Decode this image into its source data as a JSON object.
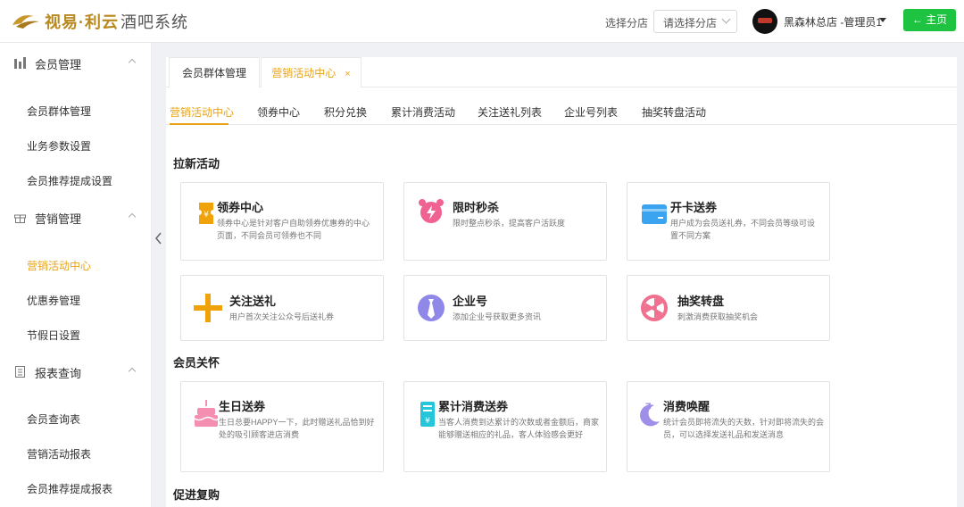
{
  "header": {
    "brand_main": "视易·利云",
    "brand_sub": "酒吧系统",
    "branch_label": "选择分店",
    "branch_placeholder": "请选择分店",
    "user_name": "黑森林总店 -管理员1",
    "home_button": "← 主页"
  },
  "sidebar": {
    "groups": [
      {
        "label": "会员管理",
        "items": [
          "会员群体管理",
          "业务参数设置",
          "会员推荐提成设置"
        ]
      },
      {
        "label": "营销管理",
        "items": [
          "营销活动中心",
          "优惠券管理",
          "节假日设置"
        ]
      },
      {
        "label": "报表查询",
        "items": [
          "会员查询表",
          "营销活动报表",
          "会员推荐提成报表"
        ]
      }
    ],
    "active_item": "营销活动中心"
  },
  "top_tabs": [
    {
      "label": "会员群体管理"
    },
    {
      "label": "营销活动中心",
      "close": "×"
    }
  ],
  "sub_nav": [
    "营销活动中心",
    "领券中心",
    "积分兑换",
    "累计消费活动",
    "关注送礼列表",
    "企业号列表",
    "抽奖转盘活动"
  ],
  "sections": [
    {
      "title": "拉新活动",
      "cards": [
        {
          "title": "领券中心",
          "desc": "领券中心是针对客户自助领券优惠券的中心页面，不同会员可领券也不同",
          "icon": "coupon-icon",
          "color": "#f0a20b"
        },
        {
          "title": "限时秒杀",
          "desc": "限时整点秒杀，提高客户活跃度",
          "icon": "alarm-clock-icon",
          "color": "#f06292"
        },
        {
          "title": "开卡送券",
          "desc": "用户成为会员送礼券，不同会员等级可设置不同方案",
          "icon": "card-icon",
          "color": "#3aa4f0"
        },
        {
          "title": "关注送礼",
          "desc": "用户首次关注公众号后送礼券",
          "icon": "plus-icon",
          "color": "#f0a20b"
        },
        {
          "title": "企业号",
          "desc": "添加企业号获取更多资讯",
          "icon": "tie-icon",
          "color": "#8f88e8"
        },
        {
          "title": "抽奖转盘",
          "desc": "刺激消费获取抽奖机会",
          "icon": "wheel-icon",
          "color": "#f07090"
        }
      ]
    },
    {
      "title": "会员关怀",
      "cards": [
        {
          "title": "生日送券",
          "desc": "生日总要HAPPY一下，此时赠送礼品恰到好处的吸引顾客进店消费",
          "icon": "cake-icon",
          "color": "#f48fb1"
        },
        {
          "title": "累计消费送券",
          "desc": "当客人消费到达累计的次数或者金额后，商家能够赠送相应的礼品，客人体验感会更好",
          "icon": "receipt-icon",
          "color": "#26c6da"
        },
        {
          "title": "消费唤醒",
          "desc": "统计会员即将流失的天数，针对即将流失的会员，可以选择发送礼品和发送消息",
          "icon": "moon-icon",
          "color": "#9f8fe8"
        }
      ]
    },
    {
      "title": "促进复购",
      "cards": []
    }
  ]
}
